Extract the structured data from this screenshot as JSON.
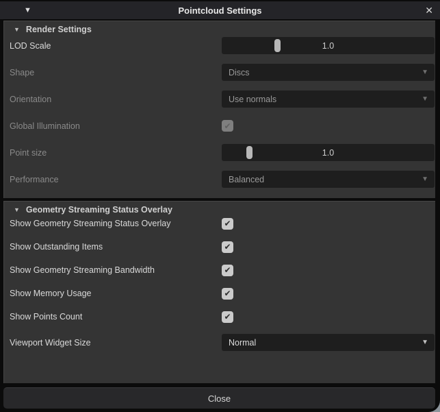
{
  "window": {
    "title": "Pointcloud Settings",
    "collapse_icon": "▼",
    "close_icon": "✕"
  },
  "icons": {
    "section_collapse": "▼",
    "dropdown_arrow": "▼",
    "checkmark": "✔"
  },
  "colors": {
    "titlebar_bg": "#242428",
    "section_bg": "#343434",
    "field_bg": "#1e1e1e",
    "outer_bg": "#0b0b0b",
    "corner_backdrop": "#8d959c",
    "slider_handle": "#b8b8b8",
    "label_enabled": "#d9d9d9",
    "label_disabled": "#8a8a8a"
  },
  "sections": [
    {
      "title": "Render Settings",
      "rows": [
        {
          "label": "LOD Scale",
          "type": "slider",
          "value": "1.0",
          "percent": 26,
          "enabled": true
        },
        {
          "label": "Shape",
          "type": "dropdown",
          "value": "Discs",
          "enabled": false
        },
        {
          "label": "Orientation",
          "type": "dropdown",
          "value": "Use normals",
          "enabled": false
        },
        {
          "label": "Global Illumination",
          "type": "checkbox",
          "checked": true,
          "enabled": false
        },
        {
          "label": "Point size",
          "type": "slider",
          "value": "1.0",
          "percent": 13,
          "enabled": false
        },
        {
          "label": "Performance",
          "type": "dropdown",
          "value": "Balanced",
          "enabled": false
        }
      ]
    },
    {
      "title": "Geometry Streaming Status Overlay",
      "rows": [
        {
          "label": "Show Geometry Streaming Status Overlay",
          "type": "checkbox",
          "checked": true,
          "enabled": true
        },
        {
          "label": "Show Outstanding Items",
          "type": "checkbox",
          "checked": true,
          "enabled": true
        },
        {
          "label": "Show Geometry Streaming Bandwidth",
          "type": "checkbox",
          "checked": true,
          "enabled": true
        },
        {
          "label": "Show Memory Usage",
          "type": "checkbox",
          "checked": true,
          "enabled": true
        },
        {
          "label": "Show Points Count",
          "type": "checkbox",
          "checked": true,
          "enabled": true
        },
        {
          "label": "Viewport Widget Size",
          "type": "dropdown",
          "value": "Normal",
          "enabled": true
        }
      ]
    }
  ],
  "footer": {
    "close_button": "Close"
  }
}
